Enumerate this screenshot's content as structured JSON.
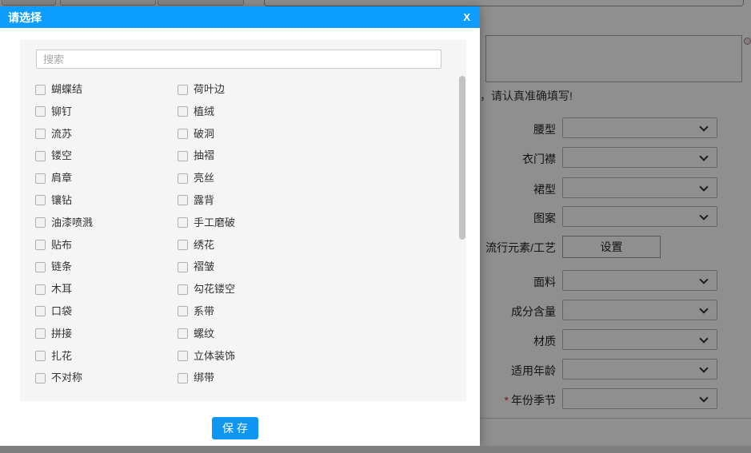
{
  "modal": {
    "title": "请选择",
    "close_label": "X",
    "search": {
      "placeholder": "搜索"
    },
    "options": [
      "蝴蝶结",
      "荷叶边",
      "铆钉",
      "植绒",
      "流苏",
      "破洞",
      "镂空",
      "抽褶",
      "肩章",
      "亮丝",
      "镶钻",
      "露背",
      "油漆喷溅",
      "手工磨破",
      "贴布",
      "绣花",
      "链条",
      "褶皱",
      "木耳",
      "勾花镂空",
      "口袋",
      "系带",
      "拼接",
      "螺纹",
      "扎花",
      "立体装饰",
      "不对称",
      "绑带"
    ],
    "save_label": "保 存"
  },
  "background": {
    "hint_text": "，请认真准确填写!",
    "required_marker": "*",
    "fields": [
      {
        "label": "腰型",
        "control": "select",
        "value": ""
      },
      {
        "label": "衣门襟",
        "control": "select",
        "value": ""
      },
      {
        "label": "裙型",
        "control": "select",
        "value": ""
      },
      {
        "label": "图案",
        "control": "select",
        "value": ""
      },
      {
        "label": "流行元素/工艺",
        "control": "button",
        "button_label": "设置"
      },
      {
        "label": "面料",
        "control": "select",
        "value": ""
      },
      {
        "label": "成分含量",
        "control": "select",
        "value": ""
      },
      {
        "label": "材质",
        "control": "select",
        "value": ""
      },
      {
        "label": "适用年龄",
        "control": "select",
        "value": ""
      },
      {
        "label": "年份季节",
        "control": "select",
        "value": "",
        "required": true
      }
    ]
  },
  "colors": {
    "header_blue": "#0c9dff",
    "save_button_blue": "#0e96f5",
    "required_red": "#c9302c"
  }
}
